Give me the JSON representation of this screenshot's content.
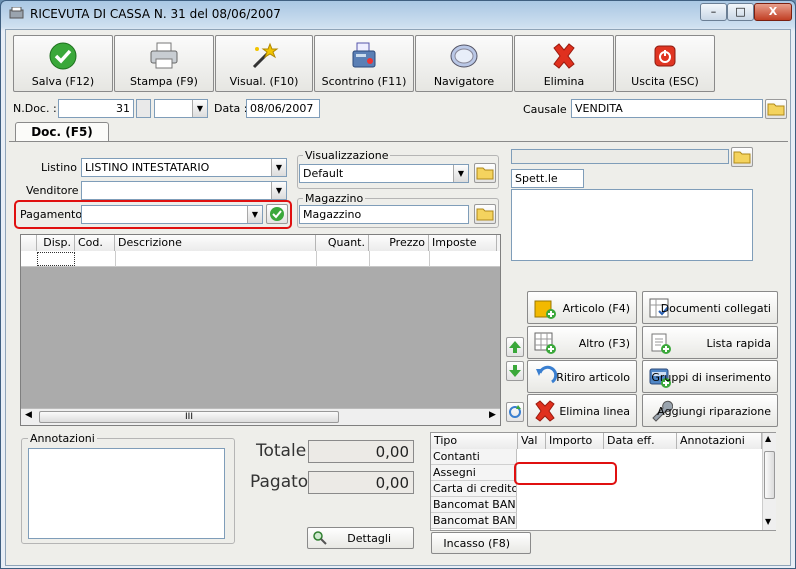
{
  "window": {
    "title": "RICEVUTA DI CASSA N. 31  del 08/06/2007",
    "min_label": "–",
    "max_label": "□",
    "close_label": "X"
  },
  "toolbar": {
    "save": "Salva (F12)",
    "print": "Stampa (F9)",
    "preview": "Visual. (F10)",
    "receipt": "Scontrino (F11)",
    "navigator": "Navigatore",
    "delete": "Elimina",
    "exit": "Uscita (ESC)"
  },
  "header": {
    "ndoc_label": "N.Doc. :",
    "ndoc_value": "31",
    "data_label": "Data :",
    "data_value": "08/06/2007",
    "causale_label": "Causale :",
    "causale_value": "VENDITA"
  },
  "tab": {
    "label": "Doc. (F5)"
  },
  "form": {
    "listino_label": "Listino :",
    "listino_value": "LISTINO INTESTATARIO",
    "venditore_label": "Venditore :",
    "venditore_value": "",
    "pagamento_label": "Pagamento :",
    "pagamento_value": "",
    "visualizzazione_label": "Visualizzazione",
    "visualizzazione_value": "Default",
    "magazzino_label": "Magazzino",
    "magazzino_value": "Magazzino",
    "customer_name": "Spett.le"
  },
  "grid": {
    "columns": [
      "Disp.",
      "Cod.",
      "Descrizione",
      "Quant.",
      "Prezzo",
      "Imposte"
    ],
    "scroll_center": "III"
  },
  "actions": {
    "articolo": "Articolo (F4)",
    "documenti": "Documenti collegati",
    "altro": "Altro (F3)",
    "lista": "Lista rapida",
    "ritiro": "Ritiro articolo",
    "gruppi": "Gruppi di inserimento",
    "elimina_linea": "Elimina linea",
    "riparazione": "Aggiungi riparazione"
  },
  "notes": {
    "label": "Annotazioni"
  },
  "totals": {
    "totale_label": "Totale",
    "totale_value": "0,00",
    "pagato_label": "Pagato",
    "pagato_value": "0,00",
    "dettagli": "Dettagli"
  },
  "payments": {
    "columns": [
      "Tipo",
      "Val",
      "Importo",
      "Data eff.",
      "Annotazioni"
    ],
    "rows": [
      "Contanti",
      "Assegni",
      "Carta di credito",
      "Bancomat BANC.",
      "Bancomat BANC."
    ],
    "incasso": "Incasso (F8)"
  },
  "colors": {
    "highlight_red": "#e01010",
    "accent_green": "#2f9e2f"
  }
}
